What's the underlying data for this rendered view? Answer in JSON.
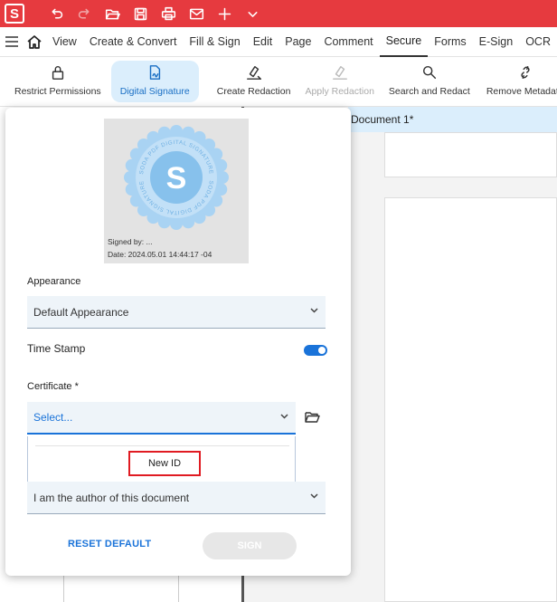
{
  "toolbar": {
    "logo_letter": "S",
    "icons": [
      "undo-icon",
      "redo-icon",
      "open-icon",
      "save-icon",
      "print-icon",
      "mail-icon",
      "add-icon",
      "chevron-down-icon"
    ]
  },
  "menu": {
    "items": [
      "View",
      "Create & Convert",
      "Fill & Sign",
      "Edit",
      "Page",
      "Comment",
      "Secure",
      "Forms",
      "E-Sign",
      "OCR"
    ],
    "active": "Secure"
  },
  "ribbon": {
    "items": [
      {
        "label": "Restrict Permissions",
        "icon": "lock-icon"
      },
      {
        "label": "Digital Signature",
        "icon": "signature-icon"
      },
      {
        "label": "Create Redaction",
        "icon": "redaction-icon"
      },
      {
        "label": "Apply Redaction",
        "icon": "apply-redaction-icon"
      },
      {
        "label": "Search and Redact",
        "icon": "search-icon"
      },
      {
        "label": "Remove Metadata",
        "icon": "unlink-icon"
      }
    ]
  },
  "document": {
    "tab_title": "Document 1*"
  },
  "panel": {
    "seal_letter": "S",
    "seal_text_top": "SODA PDF DIGITAL SIGNATURE",
    "seal_text_bottom": "SODA PDF DIGITAL SIGNATURE",
    "signed_by": "Signed by: ...",
    "date": "Date: 2024.05.01 14:44:17 -04",
    "appearance_label": "Appearance",
    "appearance_value": "Default Appearance",
    "timestamp_label": "Time Stamp",
    "timestamp_on": true,
    "certificate_label": "Certificate *",
    "certificate_placeholder": "Select...",
    "dropdown_option": "New ID",
    "reason_value": "I am the author of this document",
    "reset_label": "RESET DEFAULT",
    "sign_label": "SIGN"
  },
  "colors": {
    "titlebar": "#e63a3f",
    "accent": "#1a73d9",
    "highlight": "#e01b22"
  }
}
